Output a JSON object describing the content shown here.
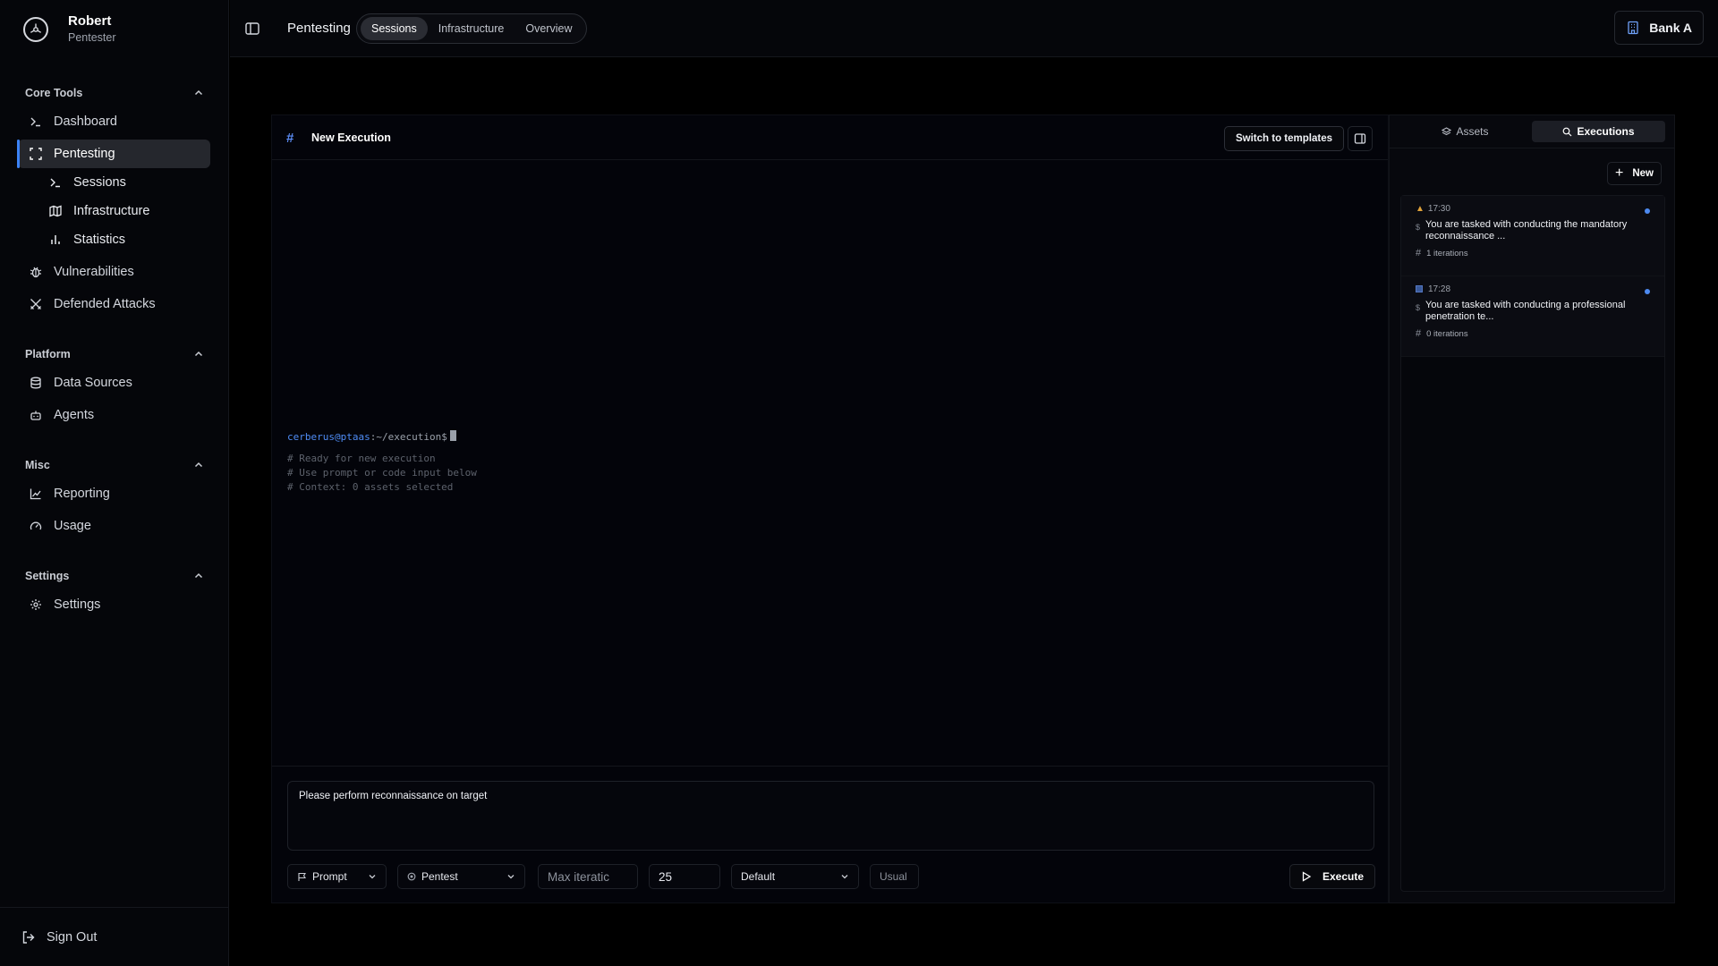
{
  "user": {
    "name": "Robert",
    "role": "Pentester"
  },
  "sidebar": {
    "sections": [
      {
        "title": "Core Tools"
      },
      {
        "title": "Platform"
      },
      {
        "title": "Misc"
      },
      {
        "title": "Settings"
      }
    ],
    "core_tools": {
      "dashboard": "Dashboard",
      "pentesting": "Pentesting",
      "sessions": "Sessions",
      "infrastructure": "Infrastructure",
      "statistics": "Statistics",
      "vulnerabilities": "Vulnerabilities",
      "defended_attacks": "Defended Attacks"
    },
    "platform": {
      "data_sources": "Data Sources",
      "agents": "Agents"
    },
    "misc": {
      "reporting": "Reporting",
      "usage": "Usage"
    },
    "settings": {
      "settings": "Settings"
    },
    "sign_out": "Sign Out"
  },
  "topbar": {
    "breadcrumb": "Pentesting",
    "tabs": [
      {
        "label": "Sessions",
        "active": true
      },
      {
        "label": "Infrastructure",
        "active": false
      },
      {
        "label": "Overview",
        "active": false
      }
    ],
    "org": "Bank A"
  },
  "main": {
    "title": "New Execution",
    "switch_label": "Switch to templates",
    "terminal": {
      "user_host": "cerberus@ptaas",
      "path": ":~/execution$",
      "lines": [
        "# Ready for new execution",
        "# Use prompt or code input below",
        "# Context: 0 assets selected"
      ]
    },
    "composer_value": "Please perform reconnaissance on target",
    "controls": {
      "mode": "Prompt",
      "type": "Pentest",
      "max_iterations_placeholder": "Max iteratic",
      "iterations_value": "25",
      "model": "Default",
      "usual": "Usual",
      "execute": "Execute"
    }
  },
  "right_panel": {
    "tabs": [
      {
        "label": "Assets",
        "active": false
      },
      {
        "label": "Executions",
        "active": true
      }
    ],
    "new_label": "New",
    "executions": [
      {
        "time": "17:30",
        "status_icon": "warning-icon",
        "text": "You are tasked with conducting the mandatory reconnaissance ...",
        "iterations": "1 iterations"
      },
      {
        "time": "17:28",
        "status_icon": "square-icon",
        "text": "You are tasked with conducting a professional penetration te...",
        "iterations": "0 iterations"
      }
    ]
  },
  "colors": {
    "accent": "#3b82f6",
    "warning": "#e0a23a",
    "background": "#000000"
  }
}
